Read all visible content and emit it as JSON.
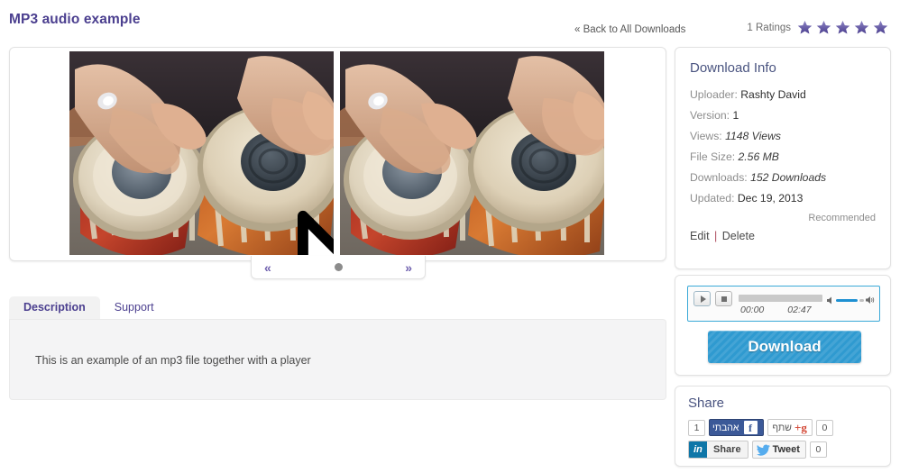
{
  "header": {
    "title": "MP3 audio example",
    "back_link": "« Back to All Downloads",
    "ratings_label": "1 Ratings",
    "stars_count": 5,
    "star_color": "#5b4b9e"
  },
  "gallery": {
    "slides": 2,
    "alt": "Hands playing tabla drums",
    "nav": {
      "prev": "«",
      "next": "»",
      "dot": "●"
    }
  },
  "tabs": {
    "items": [
      {
        "label": "Description",
        "active": true
      },
      {
        "label": "Support",
        "active": false
      }
    ],
    "content": "This is an example of an mp3 file together with a player"
  },
  "download_info": {
    "heading": "Download Info",
    "rows": [
      {
        "label": "Uploader:",
        "value": "Rashty David",
        "italic": false
      },
      {
        "label": "Version:",
        "value": "1",
        "italic": false
      },
      {
        "label": "Views:",
        "value": "1148 Views",
        "italic": true
      },
      {
        "label": "File Size:",
        "value": "2.56 MB",
        "italic": true
      },
      {
        "label": "Downloads:",
        "value": "152 Downloads",
        "italic": true
      },
      {
        "label": "Updated:",
        "value": "Dec 19, 2013",
        "italic": false
      }
    ],
    "recommended": "Recommended",
    "edit_label": "Edit",
    "separator": "|",
    "delete_label": "Delete"
  },
  "player": {
    "current_time": "00:00",
    "total_time": "02:47",
    "border_color": "#3aa9d8",
    "volume_color": "#1e90d2",
    "play_icon": "play-icon",
    "stop_icon": "stop-icon",
    "download_label": "Download",
    "download_color": "#2f9ad0"
  },
  "share": {
    "heading": "Share",
    "facebook": {
      "count": "1",
      "label": "אהבתי",
      "glyph": "f",
      "color": "#3b5998"
    },
    "googleplus": {
      "count": "0",
      "label": "שתף",
      "glyph": "g+",
      "color": "#d34836"
    },
    "linkedin": {
      "label": "Share",
      "glyph": "in",
      "color": "#0e76a8"
    },
    "twitter": {
      "label": "Tweet",
      "count": "0",
      "color": "#55acee"
    }
  }
}
